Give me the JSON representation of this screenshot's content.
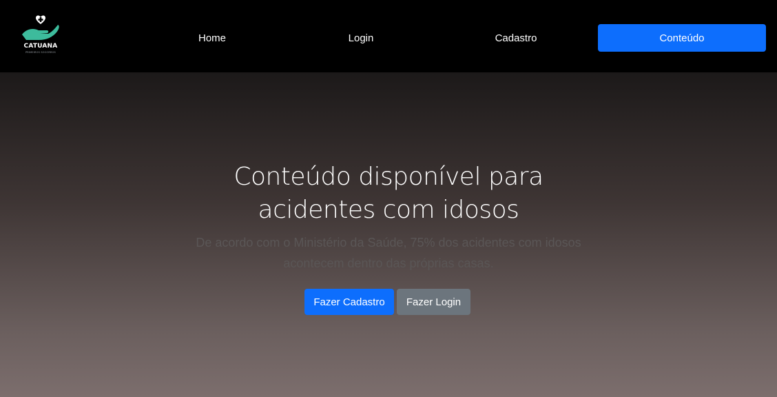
{
  "brand": {
    "name": "CATUANA",
    "tagline": "PRIMEIROS SOCORROS",
    "logo_icon": "heart-hand-icon",
    "logo_color": "#3dbb9c"
  },
  "nav": {
    "home": "Home",
    "login": "Login",
    "cadastro": "Cadastro",
    "conteudo": "Conteúdo"
  },
  "hero": {
    "title": "Conteúdo disponível para acidentes com idosos",
    "subtitle": "De acordo com o Ministério da Saúde, 75% dos acidentes com idosos acontecem dentro das próprias casas.",
    "primary_button": "Fazer Cadastro",
    "secondary_button": "Fazer Login"
  },
  "colors": {
    "navbar_bg": "#000000",
    "primary": "#0d6efd",
    "secondary": "#6c757d"
  }
}
